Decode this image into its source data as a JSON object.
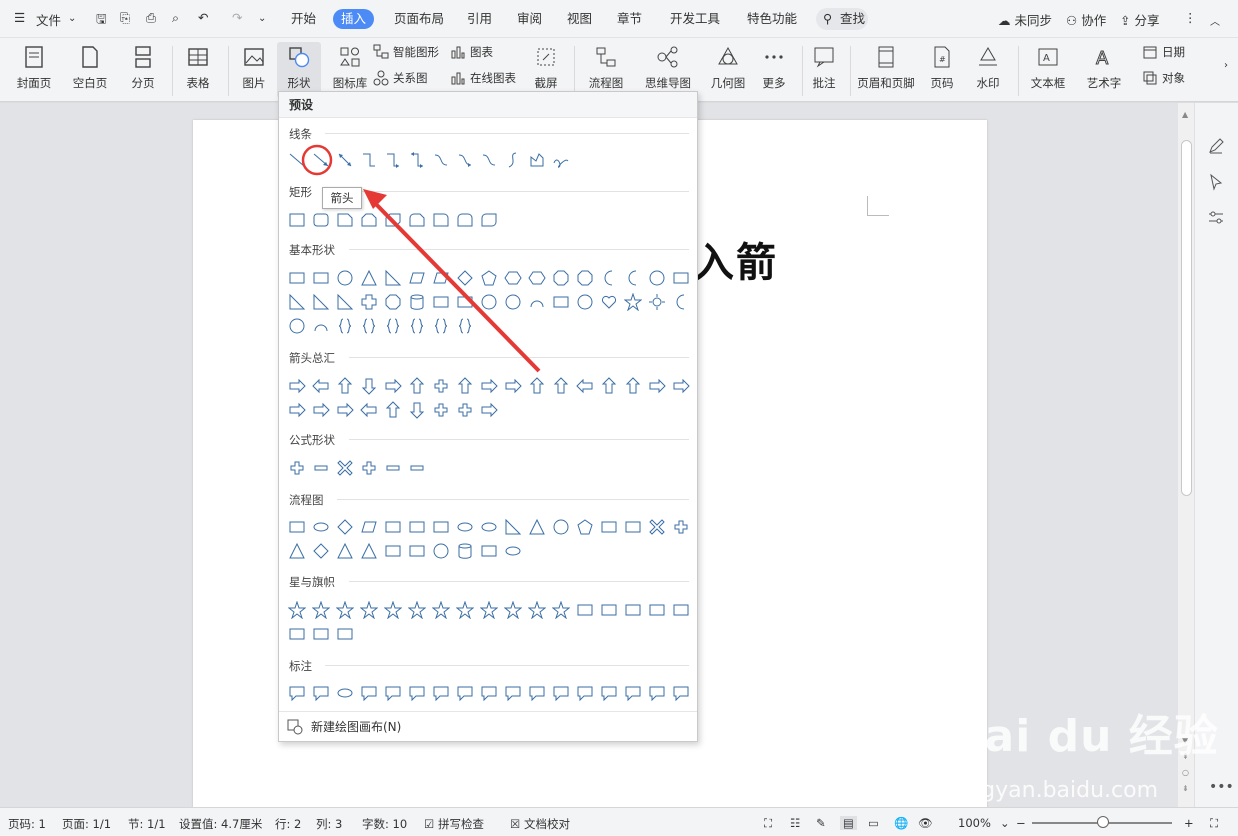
{
  "menubar": {
    "file_label": "文件",
    "tabs": [
      {
        "label": "开始"
      },
      {
        "label": "插入"
      },
      {
        "label": "页面布局"
      },
      {
        "label": "引用"
      },
      {
        "label": "审阅"
      },
      {
        "label": "视图"
      },
      {
        "label": "章节"
      },
      {
        "label": "开发工具"
      },
      {
        "label": "特色功能"
      }
    ],
    "search_label": "查找",
    "sync_label": "未同步",
    "collab_label": "协作",
    "share_label": "分享"
  },
  "ribbon": {
    "cover": "封面页",
    "blank": "空白页",
    "pagebreak": "分页",
    "table": "表格",
    "picture": "图片",
    "shape": "形状",
    "iconlib": "图标库",
    "smart": "智能图形",
    "relation": "关系图",
    "chart": "图表",
    "onlinechart": "在线图表",
    "screenshot": "截屏",
    "flowchart": "流程图",
    "mindmap": "思维导图",
    "geometry": "几何图",
    "more": "更多",
    "comment": "批注",
    "headerfooter": "页眉和页脚",
    "pagenum": "页码",
    "watermark": "水印",
    "textbox": "文本框",
    "wordart": "艺术字",
    "date": "日期",
    "object": "对象"
  },
  "document": {
    "visible_text": "入箭"
  },
  "dropdown": {
    "header": "预设",
    "sections": {
      "lines": "线条",
      "rect": "矩形",
      "basic": "基本形状",
      "arrows": "箭头总汇",
      "formula": "公式形状",
      "flow": "流程图",
      "stars": "星与旗帜",
      "callout": "标注"
    },
    "footer": "新建绘图画布(N)",
    "tooltip": "箭头"
  },
  "status": {
    "page": "页码: 1",
    "pages": "页面: 1/1",
    "section": "节: 1/1",
    "setting": "设置值: 4.7厘米",
    "row": "行: 2",
    "col": "列: 3",
    "words": "字数: 10",
    "spell": "拼写检查",
    "proof": "文档校对",
    "zoom": "100%"
  },
  "watermark": {
    "brand": "Bai du 经验",
    "url": "jingyan.baidu.com"
  },
  "colors": {
    "accent": "#4c8bf5",
    "highlight": "#e53935",
    "shape_stroke": "#3a6ea5"
  },
  "icons": [
    "menu-icon",
    "save-icon",
    "undo-icon",
    "redo-icon",
    "print-icon",
    "search-icon",
    "cloud-icon",
    "user-icon",
    "share-icon",
    "more-icon",
    "close-icon",
    "pen-icon",
    "cursor-icon",
    "sliders-icon",
    "arrow-icon"
  ]
}
